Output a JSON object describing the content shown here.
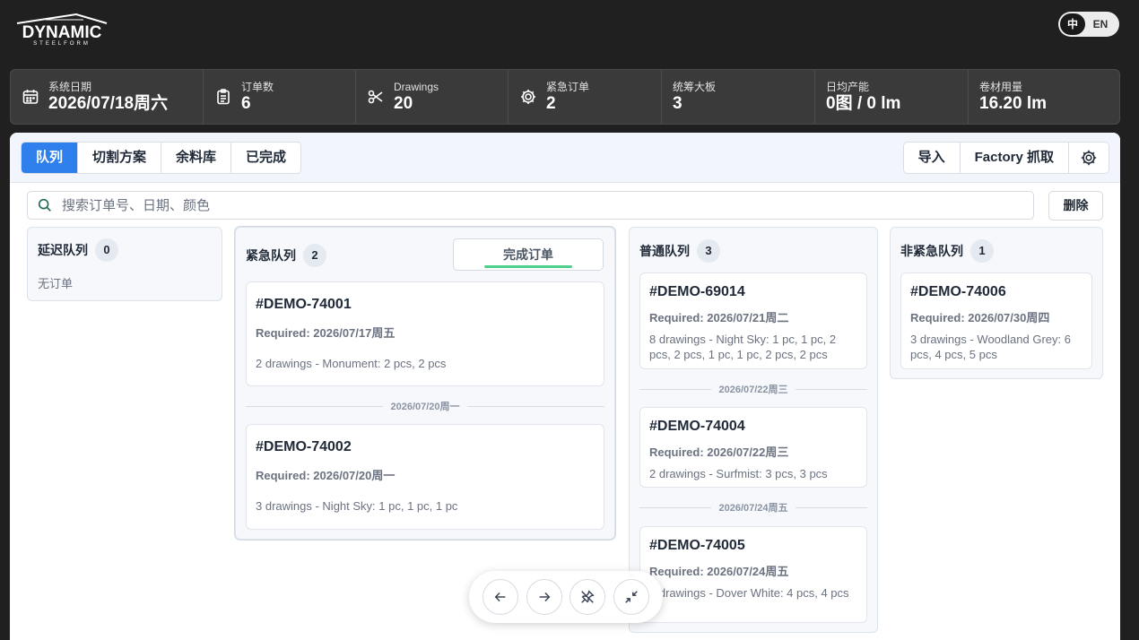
{
  "brand": {
    "name": "DYNAMIC",
    "sub": "STEELFORM"
  },
  "lang": {
    "zh": "中",
    "en": "EN"
  },
  "stats": [
    {
      "label": "系统日期",
      "value": "2026/07/18周六",
      "icon": "calendar-icon"
    },
    {
      "label": "订单数",
      "value": "6",
      "icon": "clipboard-icon"
    },
    {
      "label": "Drawings",
      "value": "20",
      "icon": "scissors-icon"
    },
    {
      "label": "紧急订单",
      "value": "2",
      "icon": "gear-icon"
    },
    {
      "label": "统筹大板",
      "value": "3",
      "icon": ""
    },
    {
      "label": "日均产能",
      "value": "0图 / 0 lm",
      "icon": ""
    },
    {
      "label": "卷材用量",
      "value": "16.20 lm",
      "icon": ""
    }
  ],
  "tabs": [
    "队列",
    "切割方案",
    "余料库",
    "已完成"
  ],
  "actions": {
    "import": "导入",
    "factory": "Factory 抓取"
  },
  "search": {
    "placeholder": "搜索订单号、日期、颜色",
    "value": ""
  },
  "delete_label": "删除",
  "columns": {
    "delayed": {
      "title": "延迟队列",
      "count": "0",
      "empty": "无订单"
    },
    "urgent": {
      "title": "紧急队列",
      "count": "2",
      "complete_label": "完成订单",
      "orders": [
        {
          "id": "#DEMO-74001",
          "required": "Required: 2026/07/17周五",
          "desc": "2 drawings - Monument: 2 pcs, 2 pcs"
        },
        {
          "id": "#DEMO-74002",
          "required": "Required: 2026/07/20周一",
          "desc": "3 drawings - Night Sky: 1 pc, 1 pc, 1 pc"
        }
      ],
      "separators": [
        "2026/07/20周一"
      ]
    },
    "normal": {
      "title": "普通队列",
      "count": "3",
      "orders": [
        {
          "id": "#DEMO-69014",
          "required": "Required: 2026/07/21周二",
          "desc": "8 drawings - Night Sky: 1 pc, 1 pc, 2 pcs, 2 pcs, 1 pc, 1 pc, 2 pcs, 2 pcs"
        },
        {
          "id": "#DEMO-74004",
          "required": "Required: 2026/07/22周三",
          "desc": "2 drawings - Surfmist: 3 pcs, 3 pcs"
        },
        {
          "id": "#DEMO-74005",
          "required": "Required: 2026/07/24周五",
          "desc": "4 drawings - Dover White: 4 pcs, 4 pcs"
        }
      ],
      "separators": [
        "2026/07/22周三",
        "2026/07/24周五"
      ]
    },
    "nonurgent": {
      "title": "非紧急队列",
      "count": "1",
      "orders": [
        {
          "id": "#DEMO-74006",
          "required": "Required: 2026/07/30周四",
          "desc": "3 drawings - Woodland Grey: 6 pcs, 4 pcs, 5 pcs"
        }
      ]
    }
  },
  "colors": {
    "accent": "#2f80ed",
    "stats_bg": "#3a3a3a",
    "page_bg": "#202020",
    "progress": "#4cd08c"
  }
}
